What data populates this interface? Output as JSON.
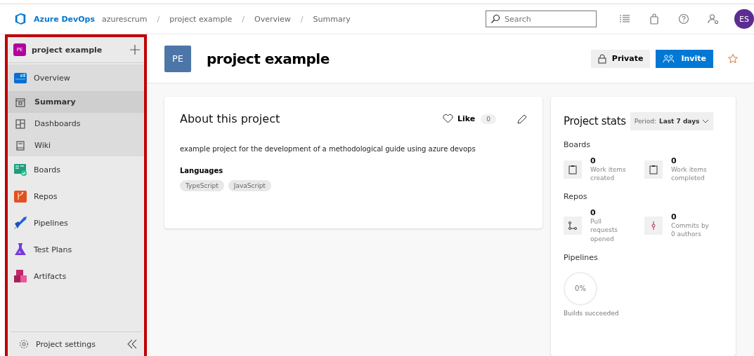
{
  "topbar": {
    "brand": "Azure DevOps",
    "breadcrumbs": [
      "azurescrum",
      "project example",
      "Overview",
      "Summary"
    ],
    "separator": "/",
    "search": {
      "placeholder": "Search"
    },
    "avatar": "ES"
  },
  "sidebar": {
    "project": {
      "initials": "PE",
      "name": "project example"
    },
    "items": [
      {
        "label": "Overview",
        "kind": "group",
        "selected": false
      },
      {
        "label": "Summary",
        "kind": "sub",
        "selected": true
      },
      {
        "label": "Dashboards",
        "kind": "sub",
        "selected": false
      },
      {
        "label": "Wiki",
        "kind": "sub",
        "selected": false
      },
      {
        "label": "Boards",
        "kind": "group",
        "selected": false
      },
      {
        "label": "Repos",
        "kind": "group",
        "selected": false
      },
      {
        "label": "Pipelines",
        "kind": "group",
        "selected": false
      },
      {
        "label": "Test Plans",
        "kind": "group",
        "selected": false
      },
      {
        "label": "Artifacts",
        "kind": "group",
        "selected": false
      }
    ],
    "settings": "Project settings"
  },
  "header": {
    "initials": "PE",
    "title": "project example",
    "private_button": "Private",
    "invite_button": "Invite",
    "favorite": false
  },
  "about": {
    "title": "About this project",
    "like": "Like",
    "like_count": "0",
    "description": "example project for the development of a methodological guide using azure devops",
    "languages_label": "Languages",
    "languages": [
      "TypeScript",
      "JavaScript"
    ]
  },
  "stats": {
    "title": "Project stats",
    "period_label": "Period:",
    "period_value": "Last 7 days",
    "sections": [
      {
        "title": "Boards",
        "metrics": [
          {
            "value": "0",
            "label": "Work items created"
          },
          {
            "value": "0",
            "label": "Work items completed"
          }
        ]
      },
      {
        "title": "Repos",
        "metrics": [
          {
            "value": "0",
            "label": "Pull requests opened"
          },
          {
            "value": "0",
            "label": "Commits by 0 authors"
          }
        ]
      }
    ],
    "pipelines": {
      "title": "Pipelines",
      "percent": "0%",
      "label": "Builds succeeded"
    }
  }
}
